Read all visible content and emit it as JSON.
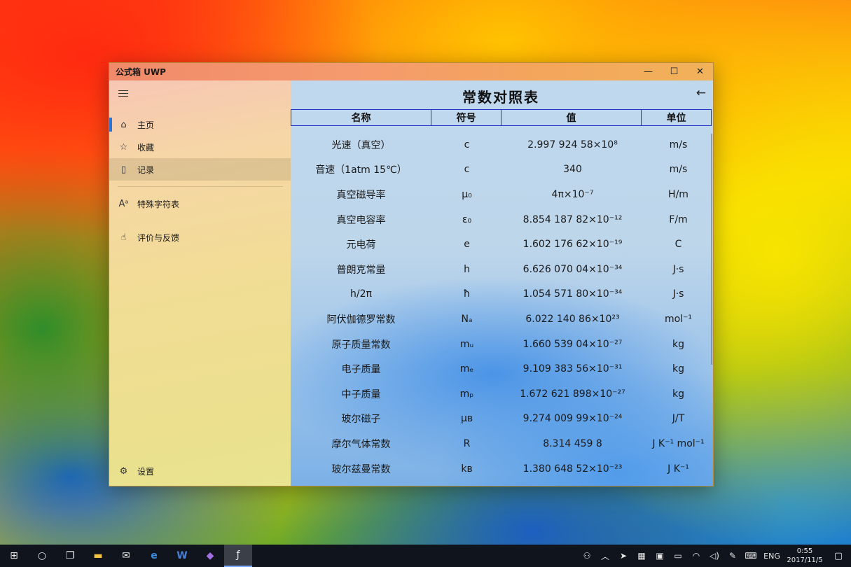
{
  "window": {
    "title": "公式箱 UWP"
  },
  "sidebar": {
    "items": [
      {
        "label": "主页",
        "icon": "home-icon"
      },
      {
        "label": "收藏",
        "icon": "star-icon"
      },
      {
        "label": "记录",
        "icon": "history-icon"
      },
      {
        "label": "特殊字符表",
        "icon": "special-chars-icon"
      },
      {
        "label": "评价与反馈",
        "icon": "feedback-icon"
      }
    ],
    "settings": "设置"
  },
  "main": {
    "title": "常数对照表",
    "columns": [
      "名称",
      "符号",
      "值",
      "单位"
    ],
    "rows": [
      {
        "name": "光速（真空）",
        "symbol": "c",
        "value": "2.997 924 58×10⁸",
        "unit": "m/s"
      },
      {
        "name": "音速（1atm 15℃）",
        "symbol": "c",
        "value": "340",
        "unit": "m/s"
      },
      {
        "name": "真空磁导率",
        "symbol": "μ₀",
        "value": "4π×10⁻⁷",
        "unit": "H/m"
      },
      {
        "name": "真空电容率",
        "symbol": "ε₀",
        "value": "8.854 187 82×10⁻¹²",
        "unit": "F/m"
      },
      {
        "name": "元电荷",
        "symbol": "e",
        "value": "1.602 176 62×10⁻¹⁹",
        "unit": "C"
      },
      {
        "name": "普朗克常量",
        "symbol": "h",
        "value": "6.626 070 04×10⁻³⁴",
        "unit": "J·s"
      },
      {
        "name": "h/2π",
        "symbol": "ħ",
        "value": "1.054 571 80×10⁻³⁴",
        "unit": "J·s"
      },
      {
        "name": "阿伏伽德罗常数",
        "symbol": "Nₐ",
        "value": "6.022 140 86×10²³",
        "unit": "mol⁻¹"
      },
      {
        "name": "原子质量常数",
        "symbol": "mᵤ",
        "value": "1.660 539 04×10⁻²⁷",
        "unit": "kg"
      },
      {
        "name": "电子质量",
        "symbol": "mₑ",
        "value": "9.109 383 56×10⁻³¹",
        "unit": "kg"
      },
      {
        "name": "中子质量",
        "symbol": "mₚ",
        "value": "1.672 621 898×10⁻²⁷",
        "unit": "kg"
      },
      {
        "name": "玻尔磁子",
        "symbol": "μʙ",
        "value": "9.274 009 99×10⁻²⁴",
        "unit": "J/T"
      },
      {
        "name": "摩尔气体常数",
        "symbol": "R",
        "value": "8.314 459 8",
        "unit": "J K⁻¹ mol⁻¹"
      },
      {
        "name": "玻尔兹曼常数",
        "symbol": "kʙ",
        "value": "1.380 648 52×10⁻²³",
        "unit": "J K⁻¹"
      }
    ]
  },
  "taskbar": {
    "language": "ENG",
    "time": "0:55",
    "date": "2017/11/5"
  },
  "colors": {
    "accent": "#2f74d0",
    "header_border": "#2233cc"
  }
}
